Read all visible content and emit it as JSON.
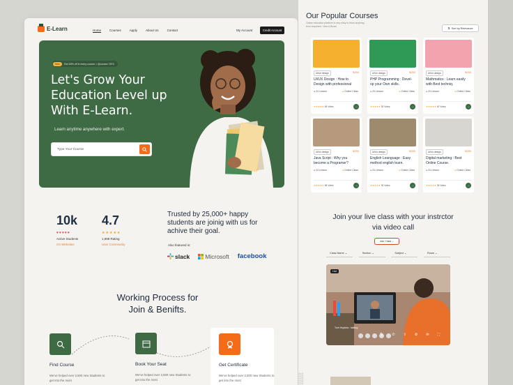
{
  "left": {
    "logo": "E-Learn",
    "nav": [
      "Home",
      "Courses",
      "Apply",
      "About Us",
      "Contact"
    ],
    "my_account": "My Account",
    "credit": "Credit Account",
    "hero": {
      "pill_tag": "New",
      "pill_text": "Get 30% off in every course > @course 7873",
      "title": "Let's Grow Your Education Level up With  E-Learn.",
      "subtitle": "Learn anytime anywhere with expert.",
      "search_placeholder": "Type Your Course"
    },
    "stats": [
      {
        "value": "10k",
        "label": "Active Students",
        "sub": "On Websites"
      },
      {
        "value": "4.7",
        "label": "1,998 Rating",
        "sub": "User Community"
      }
    ],
    "trusted": "Trusted by 25,000+ happy students are joinig with us for achive their goal.",
    "featured": "Also featured in:",
    "brands": [
      "slack",
      "Microsoft",
      "facebook"
    ],
    "working_title": "Working Process for Join & Benifts.",
    "steps": [
      {
        "title": "Find Course",
        "desc": "We've helped over 2,500 new Students to get into the most"
      },
      {
        "title": "Book Your Seat",
        "desc": "We've helped over 2,500 new Students to get into the most"
      },
      {
        "title": "Get Certificate",
        "desc": "We've helped over 2,500 new Students to get into the most"
      }
    ]
  },
  "right": {
    "title": "Our Popular Courses",
    "subtitle": "Online education platform is very easy to learn anything from anywhere. New A Boost.",
    "sort": "Sort by Relevance",
    "courses": [
      {
        "tag": "Ui/Ux design",
        "price": "$250",
        "name": "UI/UX Design : How to Design with professional",
        "lessons": "24 Lesson",
        "mode": "Online Class",
        "votes": "64 Votes",
        "color": "#f4b02e"
      },
      {
        "tag": "Ui/Ux design",
        "price": "$250",
        "name": "PHP Programming : Devel-op your Own skills.",
        "lessons": "24 Lesson",
        "mode": "Online Class",
        "votes": "30 Votes",
        "color": "#2e9a55"
      },
      {
        "tag": "Ui/Ux design",
        "price": "$250",
        "name": "Mathmatics : Learn easily with Best techniq.",
        "lessons": "24 Lesson",
        "mode": "Online Class",
        "votes": "40 Votes",
        "color": "#f3a3ae"
      },
      {
        "tag": "Ui/Ux design",
        "price": "$250",
        "name": "Java Script : Why you become a Programer?",
        "lessons": "24 Lesson",
        "mode": "Online Class",
        "votes": "56 Votes",
        "color": "#b79a7e"
      },
      {
        "tag": "Ui/Ux design",
        "price": "$250",
        "name": "English Leanguage : Easy method english learn.",
        "lessons": "24 Lesson",
        "mode": "Online Class",
        "votes": "30 Votes",
        "color": "#9e8a6c"
      },
      {
        "tag": "Ui/Ux design",
        "price": "$250",
        "name": "Digital marketing : Best Online Course.",
        "lessons": "24 Lesson",
        "mode": "Online Class",
        "votes": "26 Votes",
        "color": "#d8d6d0"
      }
    ],
    "live_title": "Join your live class with your instrctor via video call",
    "join": "Join Class",
    "filters": [
      "Class Name",
      "Section",
      "Subject",
      "Room"
    ],
    "video_tag": "Live",
    "video_name": "Tom Hopkins : talking"
  }
}
